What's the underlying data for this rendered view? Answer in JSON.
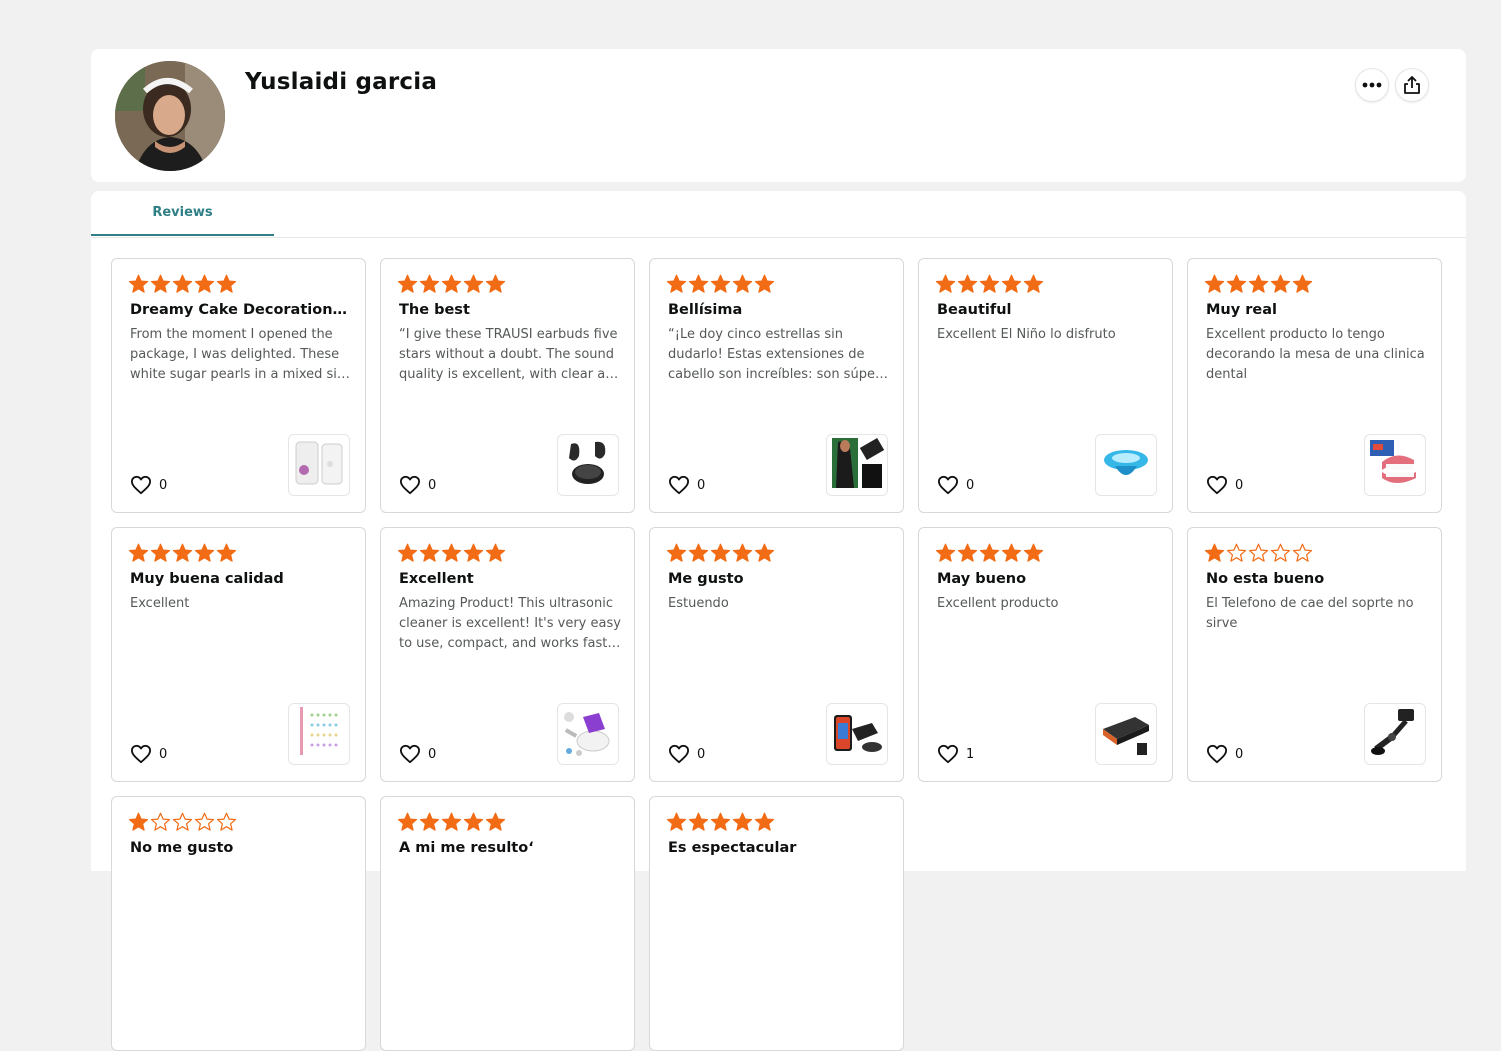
{
  "profile": {
    "name": "Yuslaidi garcia",
    "avatar_icon": "profile-photo",
    "more_icon": "more-options-icon",
    "share_icon": "share-icon"
  },
  "tabs": [
    {
      "label": "Reviews",
      "active": true
    }
  ],
  "colors": {
    "accent_teal": "#2f7f86",
    "star_orange": "#f26b15",
    "card_border": "#d5d9d9",
    "background": "#f1f1f1"
  },
  "reviews": [
    {
      "rating": 5,
      "title": "Dreamy Cake Decoration wit…",
      "body": "From the moment I opened the package, I was delighted. These white sugar pearls in a mixed si…",
      "likes": "0",
      "product_icon": "sugar-pearls-jar-icon"
    },
    {
      "rating": 5,
      "title": "The best",
      "body": "“I give these TRAUSI earbuds five stars without a doubt. The sound quality is excellent, with clear a…",
      "likes": "0",
      "product_icon": "earbuds-icon"
    },
    {
      "rating": 5,
      "title": "Bellísima",
      "body": "“¡Le doy cinco estrellas sin dudarlo! Estas extensiones de cabello son increíbles: son súpe…",
      "likes": "0",
      "product_icon": "hair-extensions-icon"
    },
    {
      "rating": 5,
      "title": "Beautiful",
      "body": "Excellent El Niño lo disfruto",
      "likes": "0",
      "product_icon": "blue-toy-icon"
    },
    {
      "rating": 5,
      "title": "Muy real",
      "body": "Excellent producto lo tengo decorando la mesa de una clinica dental",
      "likes": "0",
      "product_icon": "dental-model-icon"
    },
    {
      "rating": 5,
      "title": "Muy buena calidad",
      "body": "Excellent",
      "likes": "0",
      "product_icon": "beads-kit-icon"
    },
    {
      "rating": 5,
      "title": "Excellent",
      "body": "Amazing Product! This ultrasonic cleaner is excellent! It's very easy to use, compact, and works fast…",
      "likes": "0",
      "product_icon": "ultrasonic-cleaner-icon"
    },
    {
      "rating": 5,
      "title": "Me gusto",
      "body": "Estuendo",
      "likes": "0",
      "product_icon": "phone-mount-icon"
    },
    {
      "rating": 5,
      "title": "May bueno",
      "body": "Excellent producto",
      "likes": "1",
      "product_icon": "power-inverter-icon"
    },
    {
      "rating": 1,
      "title": "No esta bueno",
      "body": "El Telefono de cae del soprte no sirve",
      "likes": "0",
      "product_icon": "phone-holder-arm-icon"
    },
    {
      "rating": 1,
      "title": "No me gusto",
      "body": "",
      "likes": "",
      "product_icon": ""
    },
    {
      "rating": 5,
      "title": "A mi me resulto‘",
      "body": "",
      "likes": "",
      "product_icon": ""
    },
    {
      "rating": 5,
      "title": "Es espectacular",
      "body": "",
      "likes": "",
      "product_icon": ""
    }
  ]
}
